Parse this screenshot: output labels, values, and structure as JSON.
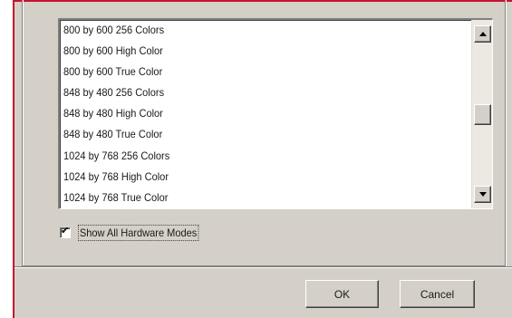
{
  "resolution_list": {
    "items": [
      "800 by 600 256 Colors",
      "800 by 600 High Color",
      "800 by 600 True Color",
      "848 by 480 256 Colors",
      "848 by 480 High Color",
      "848 by 480 True Color",
      "1024 by 768 256 Colors",
      "1024 by 768 High Color",
      "1024 by 768 True Color"
    ],
    "scroll_position": 0.5
  },
  "show_all_checkbox": {
    "label": "Show All Hardware Modes",
    "checked": true,
    "checkmark_glyph": "✔"
  },
  "buttons": {
    "ok_label": "OK",
    "cancel_label": "Cancel"
  },
  "icons": {
    "scroll_up": "scroll-up-arrow-icon",
    "scroll_down": "scroll-down-arrow-icon"
  },
  "colors": {
    "dialog_face": "#d4d0c8",
    "frame_accent": "#c8102e"
  }
}
